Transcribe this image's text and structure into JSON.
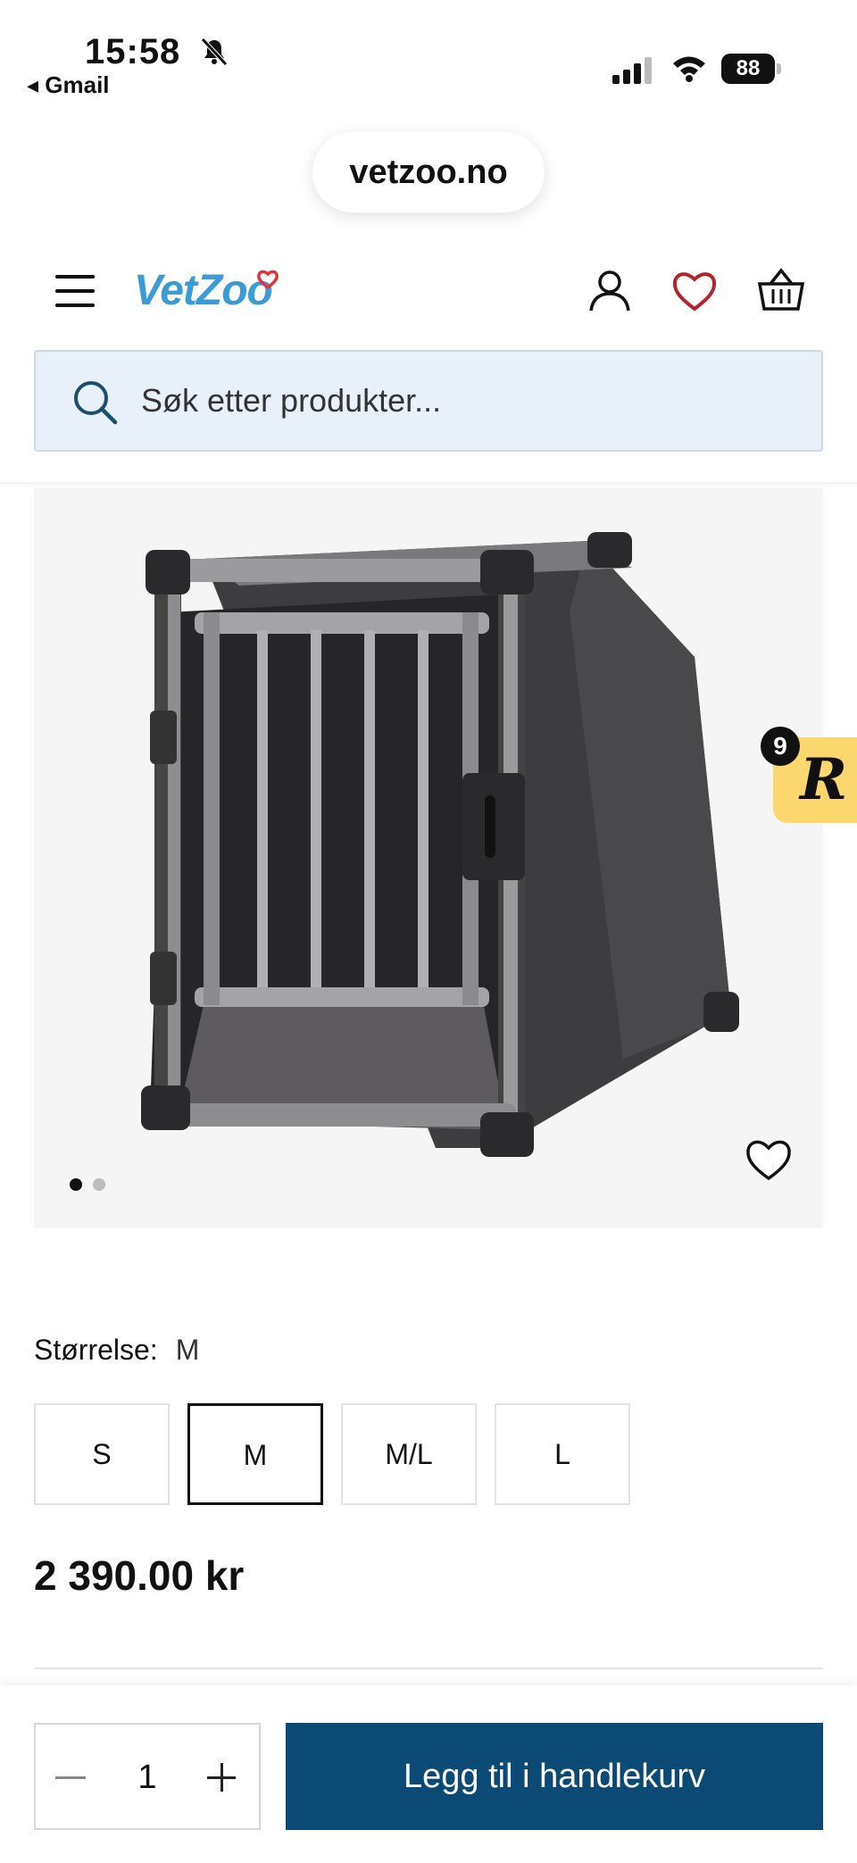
{
  "status_bar": {
    "time": "15:58",
    "back_app": "◂ Gmail",
    "battery": "88"
  },
  "browser": {
    "url": "vetzoo.no"
  },
  "header": {
    "logo_text": "VetZoo",
    "brand_color": "#3a9bd5",
    "search_placeholder": "Søk etter produkter..."
  },
  "gallery": {
    "image_alt": "dog crate",
    "image_count": 2,
    "active_index": 0
  },
  "rewards": {
    "letter": "R",
    "badge_count": "9",
    "color": "#fbd76e"
  },
  "product": {
    "size_label": "Størrelse:",
    "size_selected": "M",
    "sizes": [
      "S",
      "M",
      "M/L",
      "L"
    ],
    "price": "2 390.00 kr"
  },
  "cart": {
    "quantity": "1",
    "add_label": "Legg til i handlekurv",
    "button_color": "#0b4a75"
  }
}
